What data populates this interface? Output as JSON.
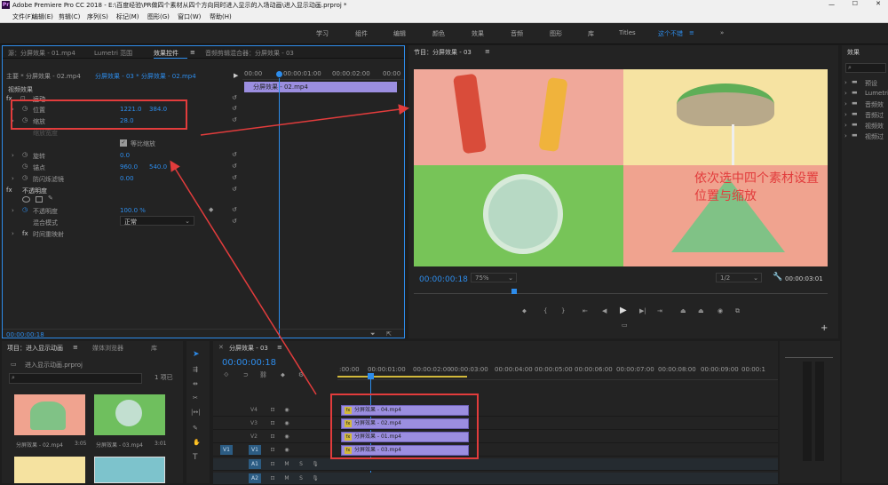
{
  "titlebar": {
    "icon": "Pr",
    "title": "Adobe Premiere Pro CC 2018 - E:\\百度经验\\PR做四个素材从四个方向同时进入显示的入场动画\\进入显示动画.prproj *"
  },
  "menu": [
    "文件(F)",
    "编辑(E)",
    "剪辑(C)",
    "序列(S)",
    "标记(M)",
    "图形(G)",
    "窗口(W)",
    "帮助(H)"
  ],
  "workspaces": [
    "学习",
    "组件",
    "编辑",
    "颜色",
    "效果",
    "音频",
    "图形",
    "库",
    "Titles",
    "这个不错",
    "»"
  ],
  "effect_controls": {
    "tabs": [
      "源：分屏效果 - 01.mp4",
      "Lumetri 范围",
      "效果控件",
      "音频剪辑混合器：分屏效果 - 03"
    ],
    "master": "主要 * 分屏效果 - 02.mp4",
    "seq": "分屏效果 - 03 * 分屏效果 - 02.mp4",
    "ruler": [
      "00:00",
      "00:00:01:00",
      "00:00:02:00",
      "00:00"
    ],
    "clip_label": "分屏效果 - 02.mp4",
    "video_effects": "视频效果",
    "motion": "运动",
    "position_label": "位置",
    "position_x": "1221.0",
    "position_y": "384.0",
    "scale_label": "缩放",
    "scale_val": "28.0",
    "scale_width_label": "缩放宽度",
    "uniform_scale": "等比缩放",
    "rotation_label": "旋转",
    "rotation_val": "0.0",
    "anchor_label": "锚点",
    "anchor_x": "960.0",
    "anchor_y": "540.0",
    "antiflicker_label": "防闪烁滤镜",
    "antiflicker_val": "0.00",
    "opacity_header": "不透明度",
    "opacity_label": "不透明度",
    "opacity_val": "100.0 %",
    "blend_label": "混合模式",
    "blend_val": "正常",
    "time_remap": "时间重映射",
    "timecode": "00:00:00:18"
  },
  "monitor": {
    "title": "节目：分屏效果 - 03",
    "annotation_line1": "依次选中四个素材设置",
    "annotation_line2": "位置与缩放",
    "timecode": "00:00:00:18",
    "zoom": "75%",
    "resolution": "1/2",
    "duration": "00:00:03:01"
  },
  "effects_panel": {
    "title": "效果",
    "items": [
      "预设",
      "Lumetri",
      "音频效",
      "音频过",
      "视频效",
      "视频过"
    ]
  },
  "project": {
    "tabs": [
      "项目：进入显示动画",
      "媒体浏览器",
      "库"
    ],
    "file": "进入显示动画.prproj",
    "count": "1 项已",
    "thumbs": [
      {
        "name": "分屏效果 - 02.mp4",
        "dur": "3:05"
      },
      {
        "name": "分屏效果 - 03.mp4",
        "dur": "3:01"
      }
    ]
  },
  "timeline": {
    "title": "分屏效果 - 03",
    "timecode": "00:00:00:18",
    "ruler": [
      ":00:00",
      "00:00:01:00",
      "00:00:02:00",
      "00:00:03:00",
      "00:00:04:00",
      "00:00:05:00",
      "00:00:06:00",
      "00:00:07:00",
      "00:00:08:00",
      "00:00:09:00",
      "00:00:1"
    ],
    "tracks": [
      "V4",
      "V3",
      "V2",
      "V1",
      "A1",
      "A2"
    ],
    "clips": [
      "分屏效果 - 04.mp4",
      "分屏效果 - 02.mp4",
      "分屏效果 - 01.mp4",
      "分屏效果 - 03.mp4"
    ],
    "src_v": "V1",
    "src_a": "A1"
  }
}
